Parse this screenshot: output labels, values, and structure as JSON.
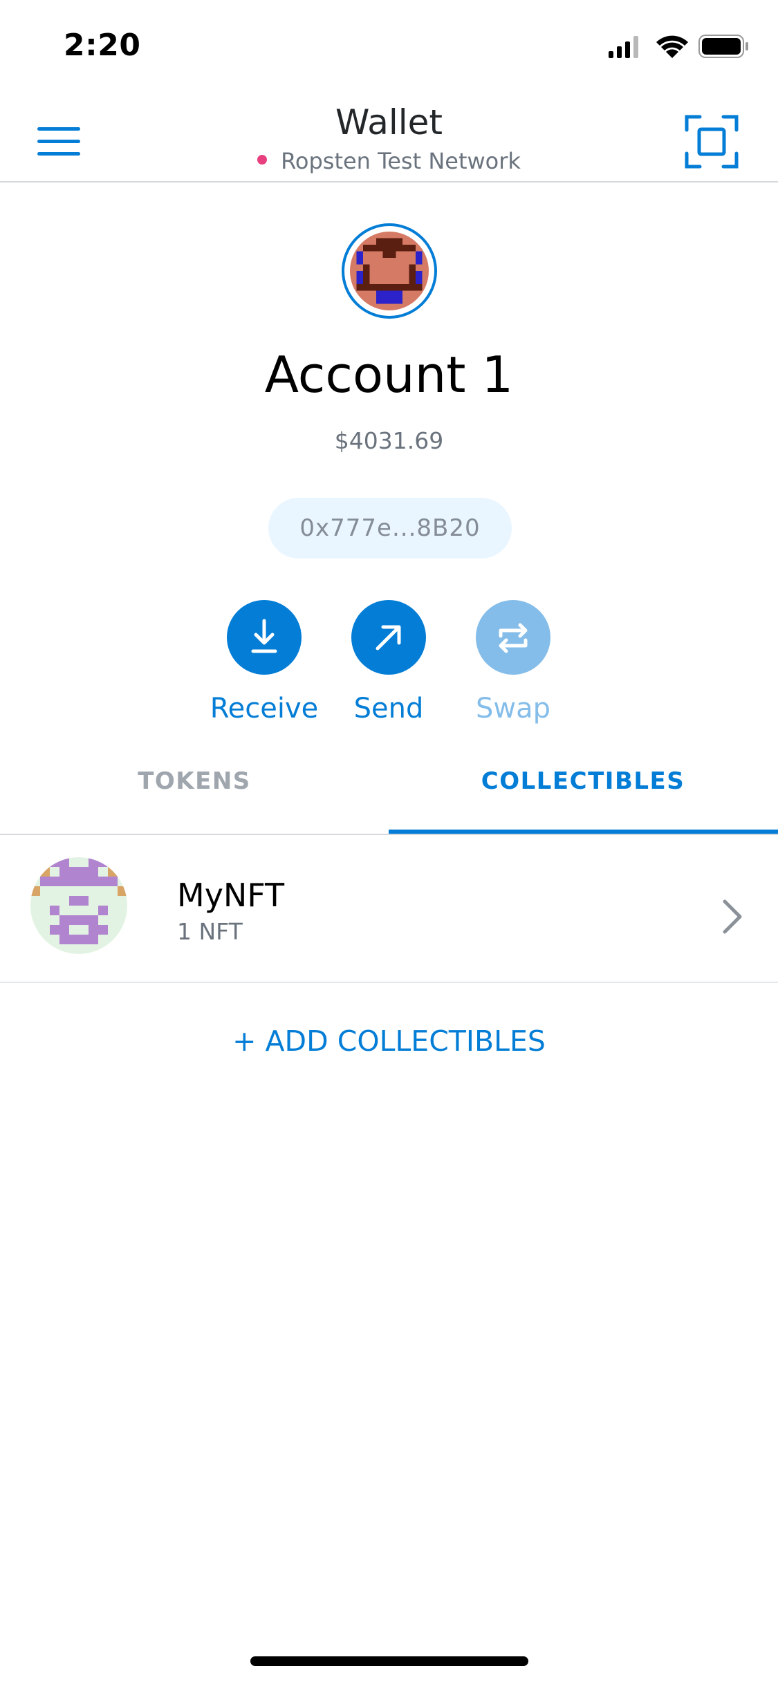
{
  "status_bar": {
    "time": "2:20",
    "icons": [
      "signal-icon",
      "wifi-icon",
      "battery-icon"
    ]
  },
  "header": {
    "title": "Wallet",
    "network": "Ropsten Test Network",
    "network_color": "#e8407f",
    "left_icon": "menu-icon",
    "right_icon": "scan-icon"
  },
  "account": {
    "name": "Account 1",
    "balance": "$4031.69",
    "address": "0x777e...8B20"
  },
  "actions": [
    {
      "label": "Receive",
      "icon": "download-icon",
      "enabled": true
    },
    {
      "label": "Send",
      "icon": "arrow-up-right-icon",
      "enabled": true
    },
    {
      "label": "Swap",
      "icon": "swap-icon",
      "enabled": false
    }
  ],
  "tabs": [
    {
      "label": "TOKENS",
      "active": false
    },
    {
      "label": "COLLECTIBLES",
      "active": true
    }
  ],
  "collectibles": [
    {
      "name": "MyNFT",
      "count": "1 NFT"
    }
  ],
  "add_collectibles_label": "+ ADD COLLECTIBLES",
  "colors": {
    "accent": "#037dd6",
    "accent_disabled": "#84bde9",
    "muted": "#6a737d",
    "pill_bg": "#eaf6ff"
  }
}
